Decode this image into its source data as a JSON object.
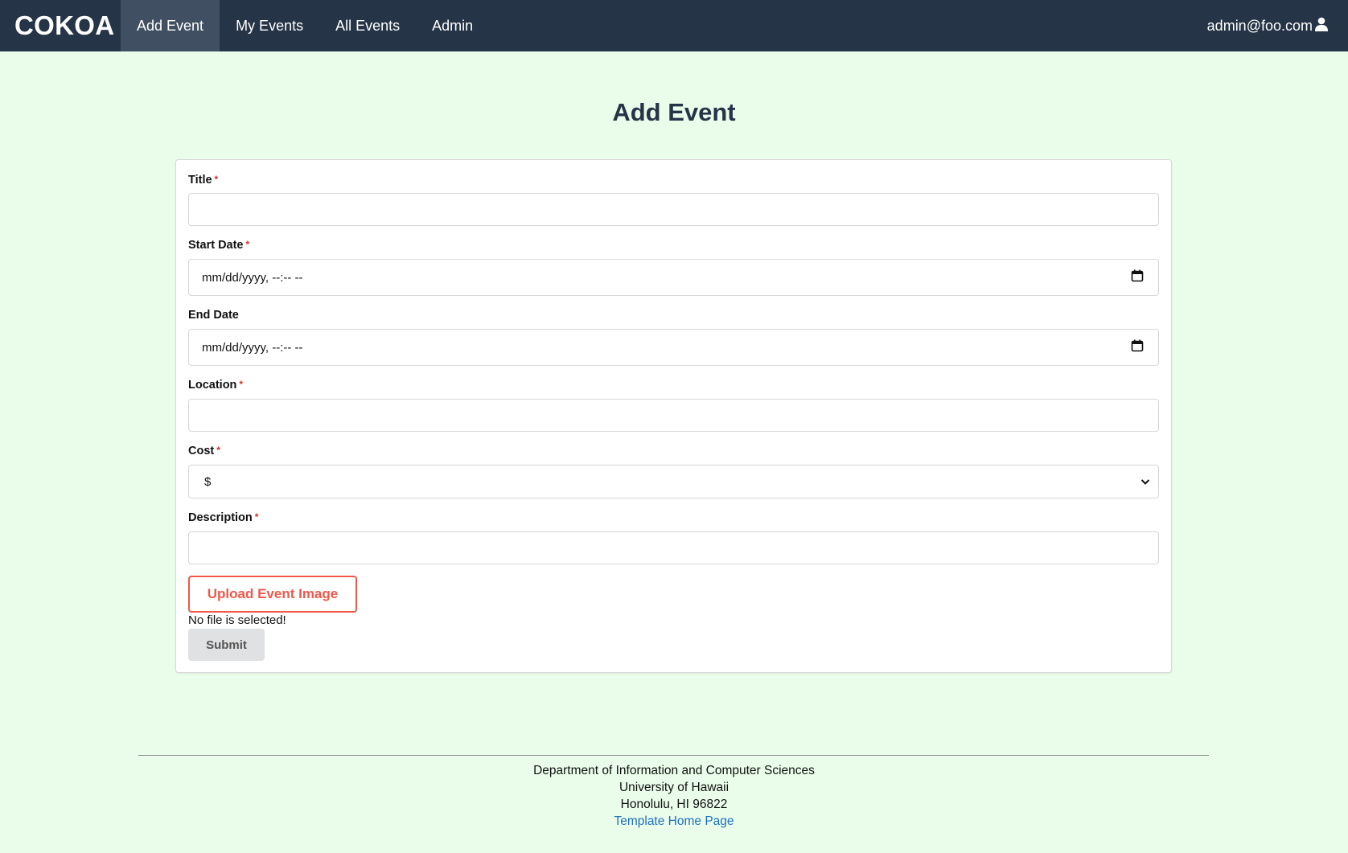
{
  "nav": {
    "brand": "COKOA",
    "items": [
      "Add Event",
      "My Events",
      "All Events",
      "Admin"
    ],
    "user": "admin@foo.com"
  },
  "page": {
    "title": "Add Event"
  },
  "form": {
    "title_label": "Title",
    "start_label": "Start Date",
    "start_value": "mm/dd/yyyy, --:-- --",
    "end_label": "End Date",
    "end_value": "mm/dd/yyyy, --:-- --",
    "location_label": "Location",
    "cost_label": "Cost",
    "cost_value": "$",
    "description_label": "Description",
    "required_mark": "*",
    "upload_label": "Upload Event Image",
    "file_status": "No file is selected!",
    "submit_label": "Submit"
  },
  "footer": {
    "line1": "Department of Information and Computer Sciences",
    "line2": "University of Hawaii",
    "line3": "Honolulu, HI 96822",
    "link": "Template Home Page"
  },
  "colors": {
    "navbar": "#263447",
    "background": "#eafdea",
    "accent": "#f2584a",
    "link": "#1e70bf"
  }
}
